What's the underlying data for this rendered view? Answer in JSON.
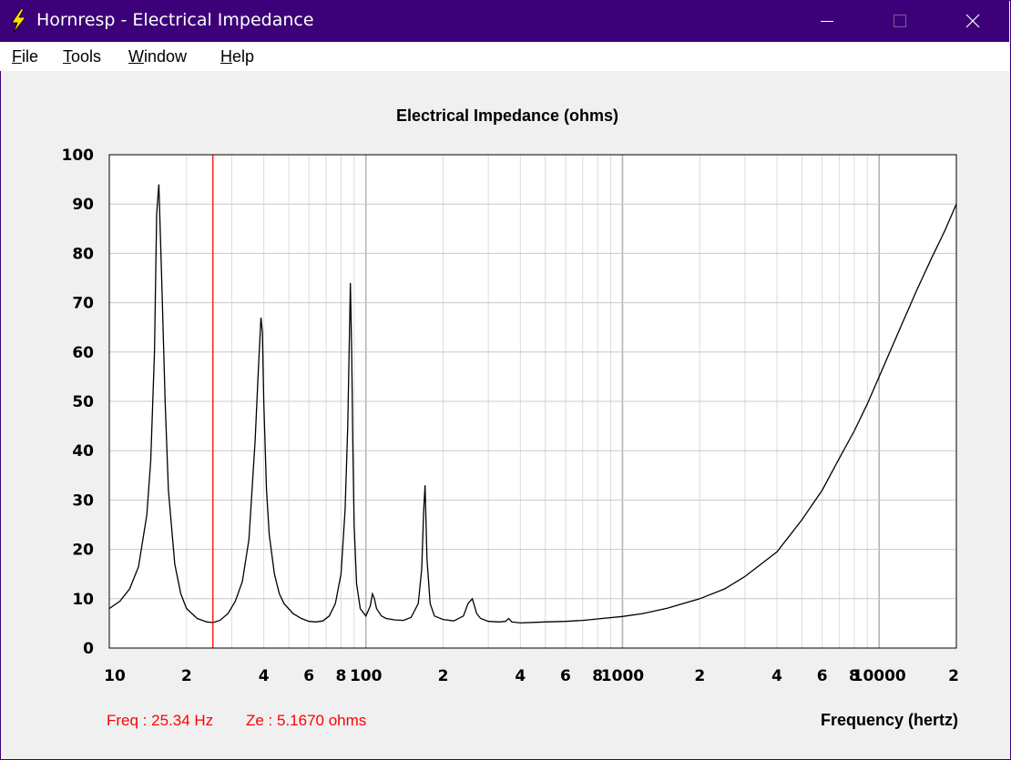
{
  "window": {
    "title": "Hornresp - Electrical Impedance"
  },
  "menu": {
    "items": [
      {
        "label": "File",
        "accel": "F",
        "rest": "ile"
      },
      {
        "label": "Tools",
        "accel": "T",
        "rest": "ools"
      },
      {
        "label": "Window",
        "accel": "W",
        "rest": "indow"
      },
      {
        "label": "Help",
        "accel": "H",
        "rest": "elp"
      }
    ]
  },
  "status": {
    "freq_text": "Freq : 25.34 Hz",
    "ze_text": "Ze : 5.1670 ohms",
    "cursor_freq": 25.34
  },
  "colors": {
    "title_bar": "#3c0078",
    "cursor": "#ff0000",
    "trace": "#000000",
    "grid": "#c8c8c8",
    "plot_bg": "#ffffff"
  },
  "chart_data": {
    "type": "line",
    "title": "Electrical Impedance (ohms)",
    "xlabel": "Frequency (hertz)",
    "ylabel": "",
    "x_scale": "log",
    "xlim": [
      10,
      20000
    ],
    "ylim": [
      0,
      100
    ],
    "grid": true,
    "y_ticks": [
      "0",
      "10",
      "20",
      "30",
      "40",
      "50",
      "60",
      "70",
      "80",
      "90",
      "100"
    ],
    "x_ticks": [
      {
        "value": 10,
        "label": "10"
      },
      {
        "value": 20,
        "label": "2"
      },
      {
        "value": 40,
        "label": "4"
      },
      {
        "value": 60,
        "label": "6"
      },
      {
        "value": 80,
        "label": "8"
      },
      {
        "value": 100,
        "label": "100"
      },
      {
        "value": 200,
        "label": "2"
      },
      {
        "value": 400,
        "label": "4"
      },
      {
        "value": 600,
        "label": "6"
      },
      {
        "value": 800,
        "label": "8"
      },
      {
        "value": 1000,
        "label": "1000"
      },
      {
        "value": 2000,
        "label": "2"
      },
      {
        "value": 4000,
        "label": "4"
      },
      {
        "value": 6000,
        "label": "6"
      },
      {
        "value": 8000,
        "label": "8"
      },
      {
        "value": 10000,
        "label": "10000"
      },
      {
        "value": 20000,
        "label": "2"
      }
    ],
    "series": [
      {
        "x": [
          10,
          11,
          12,
          13,
          14,
          14.5,
          15,
          15.3,
          15.6,
          16,
          16.5,
          17,
          18,
          19,
          20,
          22,
          24,
          25.34,
          27,
          29,
          31,
          33,
          35,
          37,
          38,
          39,
          39.5,
          40,
          41,
          42,
          44,
          46,
          48,
          52,
          56,
          60,
          64,
          68,
          72,
          76,
          80,
          83,
          85,
          86,
          87,
          88,
          89,
          90,
          92,
          95,
          100,
          104,
          106,
          108,
          110,
          115,
          120,
          130,
          140,
          150,
          160,
          165,
          168,
          170,
          173,
          178,
          185,
          200,
          220,
          240,
          250,
          260,
          265,
          270,
          280,
          300,
          330,
          350,
          360,
          370,
          400,
          450,
          500,
          600,
          700,
          800,
          1000,
          1200,
          1500,
          2000,
          2500,
          3000,
          4000,
          5000,
          6000,
          7000,
          8000,
          9000,
          10000,
          12000,
          14000,
          16000,
          18000,
          20000
        ],
        "y": [
          8,
          9.5,
          12,
          16.5,
          27,
          38,
          60,
          88,
          94,
          75,
          50,
          32,
          17,
          11,
          8,
          6,
          5.3,
          5.17,
          5.6,
          7,
          9.5,
          13.5,
          22,
          42,
          55,
          67,
          64,
          50,
          32,
          23,
          15,
          11,
          9,
          7,
          6,
          5.4,
          5.3,
          5.5,
          6.5,
          9,
          15,
          28,
          45,
          60,
          74,
          60,
          40,
          25,
          13,
          8,
          6.5,
          8.5,
          11,
          10,
          8,
          6.5,
          6,
          5.7,
          5.6,
          6.2,
          9,
          16,
          28,
          33,
          18,
          9,
          6.5,
          5.8,
          5.5,
          6.5,
          9,
          10,
          8.5,
          7,
          6,
          5.4,
          5.3,
          5.4,
          6,
          5.3,
          5.1,
          5.2,
          5.3,
          5.4,
          5.6,
          5.9,
          6.4,
          7,
          8.1,
          10,
          12,
          14.5,
          19.5,
          26,
          32,
          38.5,
          44,
          49.5,
          55,
          64.5,
          72.5,
          79,
          84.5,
          90
        ]
      }
    ]
  }
}
